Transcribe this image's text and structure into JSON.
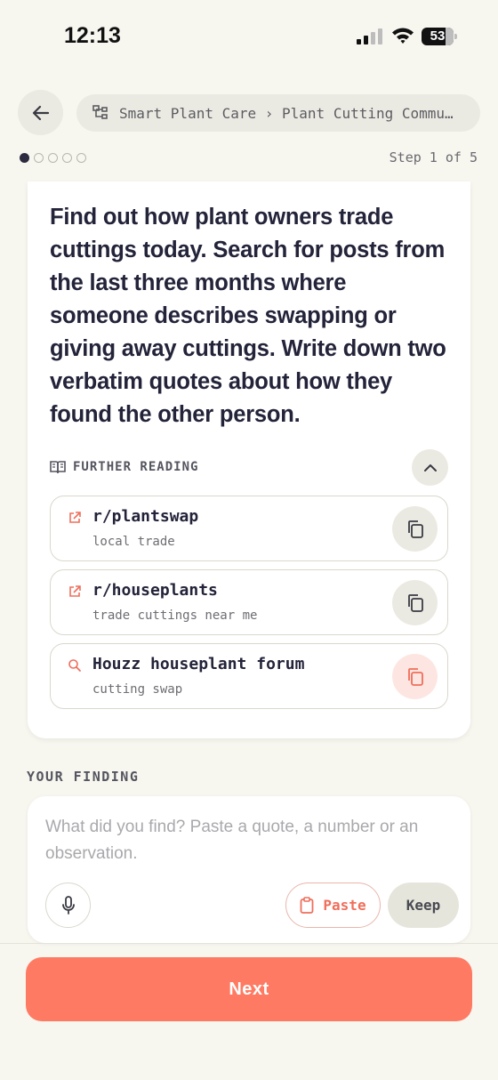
{
  "status_bar": {
    "time": "12:13",
    "battery": "53"
  },
  "header": {
    "breadcrumb": "Smart Plant Care › Plant Cutting Commu…",
    "step_label": "Step 1 of 5",
    "step_current": 1,
    "step_total": 5
  },
  "task": {
    "text": "Find out how plant owners trade cuttings today. Search for posts from the last three months where someone describes swapping or giving away cuttings. Write down two verbatim quotes about how they found the other person."
  },
  "further_reading": {
    "label": "FURTHER READING",
    "items": [
      {
        "title": "r/plantswap",
        "subtitle": "local trade",
        "icon": "external-link-icon"
      },
      {
        "title": "r/houseplants",
        "subtitle": "trade cuttings near me",
        "icon": "external-link-icon"
      },
      {
        "title": "Houzz houseplant forum",
        "subtitle": "cutting swap",
        "icon": "search-icon"
      }
    ]
  },
  "finding": {
    "label": "YOUR FINDING",
    "placeholder": "What did you find? Paste a quote, a number or an observation.",
    "value": "",
    "paste_label": "Paste",
    "keep_label": "Keep"
  },
  "footer": {
    "next_label": "Next"
  },
  "colors": {
    "accent": "#ff7a63",
    "background": "#f7f6ef",
    "text": "#23233a"
  }
}
